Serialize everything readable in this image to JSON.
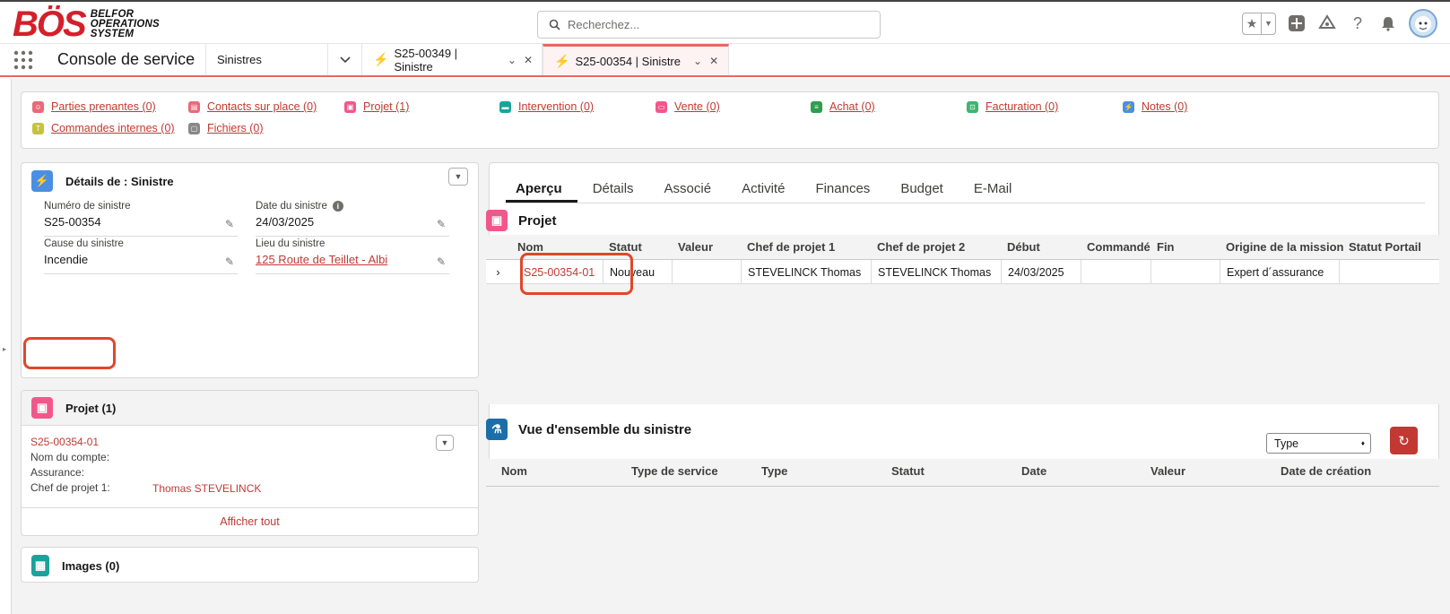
{
  "brand": {
    "logo_main": "BÖS",
    "logo_sub_1": "BELFOR",
    "logo_sub_2": "OPERATIONS",
    "logo_sub_3": "SYSTEM"
  },
  "search": {
    "placeholder": "Recherchez..."
  },
  "nav": {
    "app_name": "Console de service",
    "object_selector": "Sinistres",
    "tabs": [
      {
        "label": "S25-00349 | Sinistre",
        "active": false
      },
      {
        "label": "S25-00354 | Sinistre",
        "active": true
      }
    ]
  },
  "related_links": [
    {
      "label": "Parties prenantes (0)",
      "color": "#e96a77",
      "icon": "stakeholders-icon"
    },
    {
      "label": "Contacts sur place (0)",
      "color": "#e96a77",
      "icon": "contacts-icon"
    },
    {
      "label": "Projet (1)",
      "color": "#f2578b",
      "icon": "briefcase-icon"
    },
    {
      "label": "Intervention (0)",
      "color": "#1aa39a",
      "icon": "truck-icon"
    },
    {
      "label": "Vente (0)",
      "color": "#f2578b",
      "icon": "sale-icon"
    },
    {
      "label": "Achat (0)",
      "color": "#2e9e4f",
      "icon": "purchase-icon"
    },
    {
      "label": "Facturation (0)",
      "color": "#3bb56d",
      "icon": "invoice-icon"
    },
    {
      "label": "Notes (0)",
      "color": "#4b8fe2",
      "icon": "notes-icon"
    },
    {
      "label": "Commandes internes (0)",
      "color": "#c5c23d",
      "icon": "orders-icon"
    },
    {
      "label": "Fichiers (0)",
      "color": "#888888",
      "icon": "files-icon"
    }
  ],
  "details": {
    "title": "Détails de : Sinistre",
    "fields": {
      "numero_label": "Numéro de sinistre",
      "numero_value": "S25-00354",
      "date_label": "Date du sinistre",
      "date_value": "24/03/2025",
      "cause_label": "Cause du sinistre",
      "cause_value": "Incendie",
      "lieu_label": "Lieu du sinistre",
      "lieu_value": "125 Route de Teillet - Albi"
    }
  },
  "project_card": {
    "title": "Projet (1)",
    "record": "S25-00354-01",
    "compte_label": "Nom du compte:",
    "assurance_label": "Assurance:",
    "chef_label": "Chef de projet 1:",
    "chef_value": "Thomas STEVELINCK",
    "view_all": "Afficher tout"
  },
  "images_card": {
    "title": "Images (0)"
  },
  "main_tabs": [
    "Aperçu",
    "Détails",
    "Associé",
    "Activité",
    "Finances",
    "Budget",
    "E-Mail"
  ],
  "projet_section": {
    "title": "Projet",
    "columns": [
      "Nom",
      "Statut",
      "Valeur",
      "Chef de projet 1",
      "Chef de projet 2",
      "Début",
      "Commandé",
      "Fin",
      "Origine de la mission",
      "Statut Portail"
    ],
    "rows": [
      [
        "S25-00354-01",
        "Nouveau",
        "",
        "STEVELINCK Thomas",
        "STEVELINCK Thomas",
        "24/03/2025",
        "",
        "",
        "Expert d´assurance",
        ""
      ]
    ]
  },
  "overview_section": {
    "title": "Vue d'ensemble du sinistre",
    "filter_value": "Type",
    "columns": [
      "Nom",
      "Type de service",
      "Type",
      "Statut",
      "Date",
      "Valeur",
      "Date de création"
    ]
  }
}
